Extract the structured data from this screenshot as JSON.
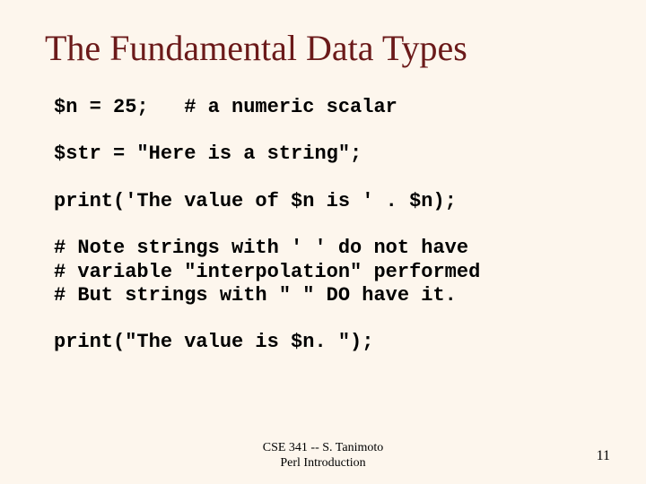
{
  "title": "The Fundamental Data Types",
  "code": {
    "line1": "$n = 25;   # a numeric scalar",
    "line2": "$str = \"Here is a string\";",
    "line3": "print('The value of $n is ' . $n);",
    "line4": "# Note strings with ' ' do not have",
    "line5": "# variable \"interpolation\" performed",
    "line6": "# But strings with \" \" DO have it.",
    "line7": "print(\"The value is $n. \");"
  },
  "footer": {
    "line1": "CSE 341 -- S. Tanimoto",
    "line2": "Perl Introduction"
  },
  "pageNumber": "11"
}
